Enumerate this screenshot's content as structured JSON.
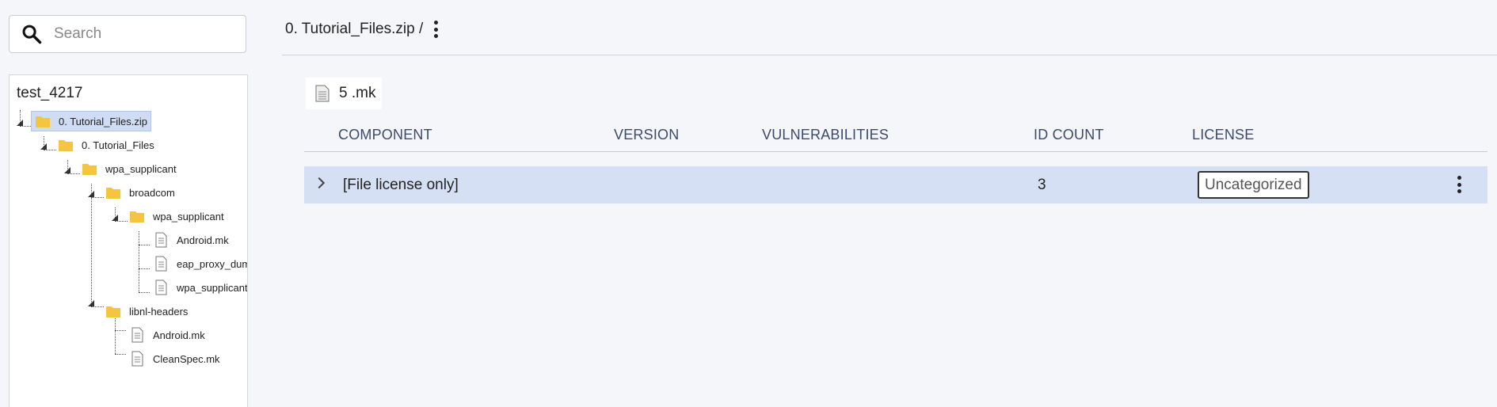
{
  "search": {
    "placeholder": "Search"
  },
  "tree": {
    "root_label": "test_4217",
    "nodes": [
      {
        "label": "0. Tutorial_Files.zip",
        "type": "folder",
        "selected": true
      },
      {
        "label": "0. Tutorial_Files",
        "type": "folder"
      },
      {
        "label": "wpa_supplicant",
        "type": "folder"
      },
      {
        "label": "broadcom",
        "type": "folder"
      },
      {
        "label": "wpa_supplicant",
        "type": "folder"
      },
      {
        "label": "Android.mk",
        "type": "file"
      },
      {
        "label": "eap_proxy_dumm",
        "type": "file"
      },
      {
        "label": "wpa_supplicant_",
        "type": "file"
      },
      {
        "label": "libnl-headers",
        "type": "folder"
      },
      {
        "label": "Android.mk",
        "type": "file"
      },
      {
        "label": "CleanSpec.mk",
        "type": "file"
      }
    ]
  },
  "breadcrumb": {
    "path": "0. Tutorial_Files.zip /"
  },
  "file_chip": {
    "label": "5 .mk",
    "icon": "file-icon"
  },
  "table": {
    "columns": [
      "COMPONENT",
      "VERSION",
      "VULNERABILITIES",
      "ID COUNT",
      "LICENSE"
    ],
    "rows": [
      {
        "component": "[File license only]",
        "version": "",
        "vulnerabilities": "",
        "id_count": "3",
        "license": "Uncategorized"
      }
    ]
  },
  "colors": {
    "selected_row": "#d5e0f5",
    "tree_selected": "#cfdcf3",
    "folder": "#f5c542",
    "header_text": "#3d4a6b"
  }
}
